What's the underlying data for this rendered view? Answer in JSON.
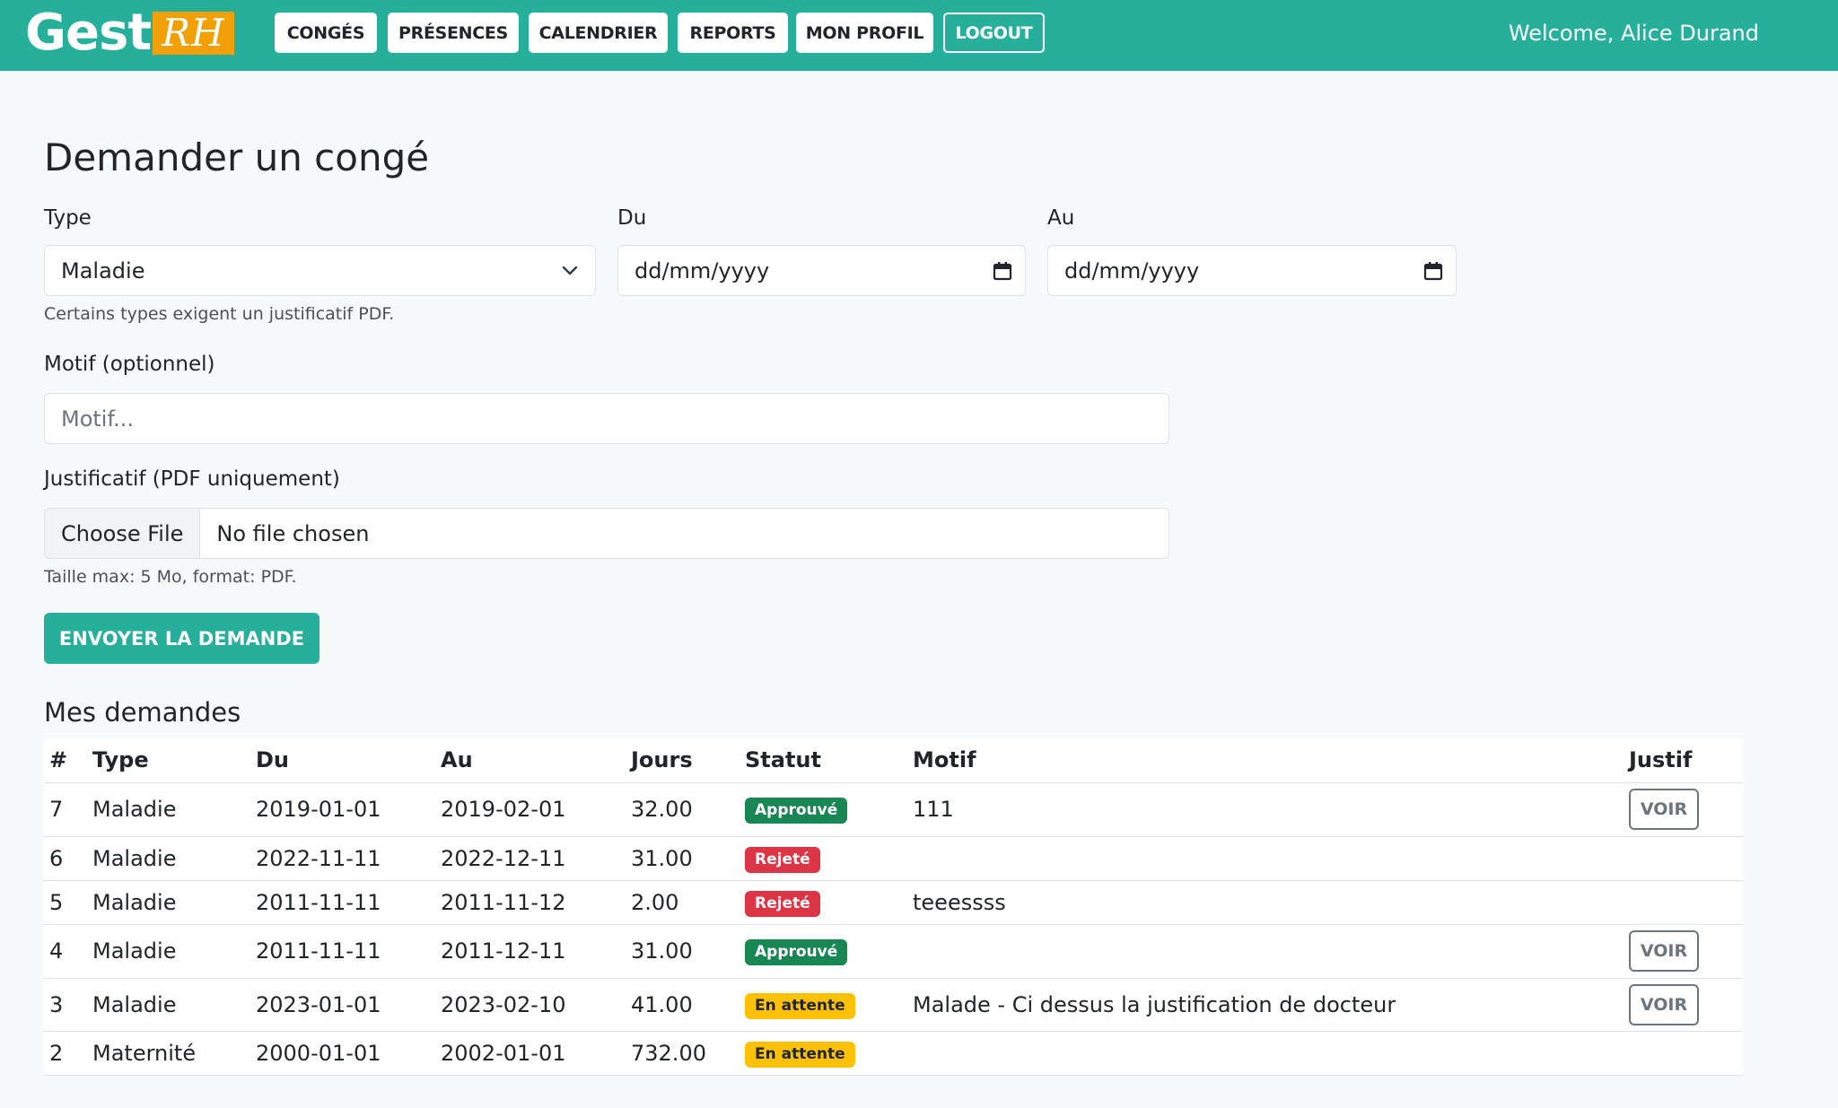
{
  "nav": {
    "brand_main": "Gest",
    "brand_accent": "RH",
    "items": [
      "CONGÉS",
      "PRÉSENCES",
      "CALENDRIER",
      "REPORTS",
      "MON PROFIL"
    ],
    "logout": "LOGOUT",
    "welcome": "Welcome, Alice Durand"
  },
  "form": {
    "title": "Demander un congé",
    "type_label": "Type",
    "type_value": "Maladie",
    "type_help": "Certains types exigent un justificatif PDF.",
    "from_label": "Du",
    "from_placeholder": "dd/mm/yyyy",
    "to_label": "Au",
    "to_placeholder": "dd/mm/yyyy",
    "motif_label": "Motif (optionnel)",
    "motif_placeholder": "Motif...",
    "file_label": "Justificatif (PDF uniquement)",
    "file_button": "Choose File",
    "file_status": "No file chosen",
    "file_help": "Taille max: 5 Mo, format: PDF.",
    "submit": "ENVOYER LA DEMANDE"
  },
  "requests": {
    "title": "Mes demandes",
    "columns": [
      "#",
      "Type",
      "Du",
      "Au",
      "Jours",
      "Statut",
      "Motif",
      "Justif"
    ],
    "rows": [
      {
        "id": "7",
        "type": "Maladie",
        "from": "2019-01-01",
        "to": "2019-02-01",
        "days": "32.00",
        "status": "Approuvé",
        "status_kind": "ok",
        "motif": "111",
        "justif": "VOIR"
      },
      {
        "id": "6",
        "type": "Maladie",
        "from": "2022-11-11",
        "to": "2022-12-11",
        "days": "31.00",
        "status": "Rejeté",
        "status_kind": "ko",
        "motif": "",
        "justif": ""
      },
      {
        "id": "5",
        "type": "Maladie",
        "from": "2011-11-11",
        "to": "2011-11-12",
        "days": "2.00",
        "status": "Rejeté",
        "status_kind": "ko",
        "motif": "teeessss",
        "justif": ""
      },
      {
        "id": "4",
        "type": "Maladie",
        "from": "2011-11-11",
        "to": "2011-12-11",
        "days": "31.00",
        "status": "Approuvé",
        "status_kind": "ok",
        "motif": "",
        "justif": "VOIR"
      },
      {
        "id": "3",
        "type": "Maladie",
        "from": "2023-01-01",
        "to": "2023-02-10",
        "days": "41.00",
        "status": "En attente",
        "status_kind": "wait",
        "motif": "Malade - Ci dessus la justification de docteur",
        "justif": "VOIR"
      },
      {
        "id": "2",
        "type": "Maternité",
        "from": "2000-01-01",
        "to": "2002-01-01",
        "days": "732.00",
        "status": "En attente",
        "status_kind": "wait",
        "motif": "",
        "justif": ""
      }
    ]
  },
  "colors": {
    "primary": "#26b09c",
    "accent": "#f2a007",
    "approved": "#198754",
    "rejected": "#dc3545",
    "pending": "#ffc107"
  },
  "icons": {
    "type_select": "chevron-down-icon",
    "date_picker": "calendar-icon"
  }
}
